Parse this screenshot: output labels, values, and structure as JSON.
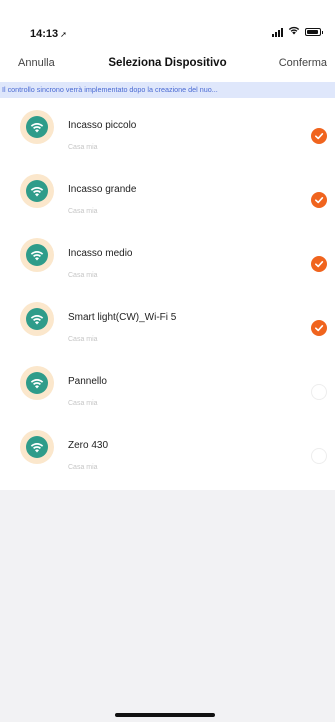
{
  "status": {
    "time": "14:13"
  },
  "nav": {
    "cancel_label": "Annulla",
    "title": "Seleziona Dispositivo",
    "confirm_label": "Conferma"
  },
  "banner": {
    "text": "Il controllo sincrono verrà implementato dopo la creazione del nuo..."
  },
  "devices": [
    {
      "name": "Incasso piccolo",
      "room": "Casa mia",
      "selected": true
    },
    {
      "name": "Incasso grande",
      "room": "Casa mia",
      "selected": true
    },
    {
      "name": "Incasso medio",
      "room": "Casa mia",
      "selected": true
    },
    {
      "name": "Smart light(CW)_Wi-Fi 5",
      "room": "Casa mia",
      "selected": true
    },
    {
      "name": "Pannello",
      "room": "Casa mia",
      "selected": false
    },
    {
      "name": "Zero 430",
      "room": "Casa mia",
      "selected": false
    }
  ],
  "colors": {
    "accent": "#f0641e",
    "banner_bg": "#dfe7fb",
    "banner_text": "#4a6ad3",
    "device_icon": "#2f9c8a",
    "device_icon_ring": "#fbe7cc"
  },
  "icons": {
    "device": "wifi-bulb-icon",
    "selected": "check-icon"
  }
}
